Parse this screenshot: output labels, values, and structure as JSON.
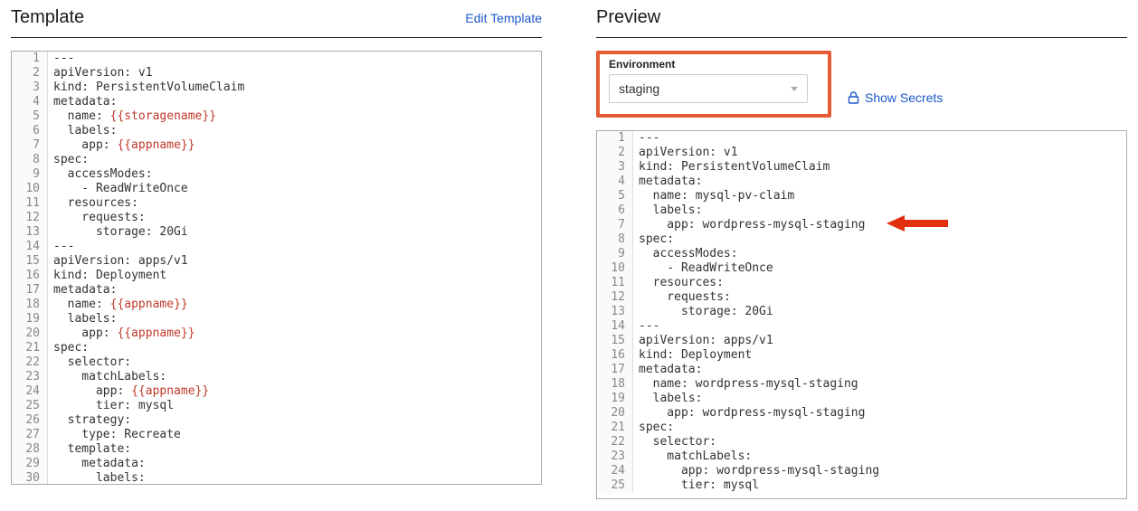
{
  "template": {
    "title": "Template",
    "edit_link": "Edit Template",
    "lines": [
      {
        "n": 1,
        "segs": [
          {
            "t": "---"
          }
        ]
      },
      {
        "n": 2,
        "segs": [
          {
            "t": "apiVersion: v1"
          }
        ]
      },
      {
        "n": 3,
        "segs": [
          {
            "t": "kind: PersistentVolumeClaim"
          }
        ]
      },
      {
        "n": 4,
        "segs": [
          {
            "t": "metadata:"
          }
        ]
      },
      {
        "n": 5,
        "segs": [
          {
            "t": "  name: "
          },
          {
            "t": "{{storagename}}",
            "cls": "tok-var"
          }
        ]
      },
      {
        "n": 6,
        "segs": [
          {
            "t": "  labels:"
          }
        ]
      },
      {
        "n": 7,
        "segs": [
          {
            "t": "    app: "
          },
          {
            "t": "{{appname}}",
            "cls": "tok-var"
          }
        ]
      },
      {
        "n": 8,
        "segs": [
          {
            "t": "spec:"
          }
        ]
      },
      {
        "n": 9,
        "segs": [
          {
            "t": "  accessModes:"
          }
        ]
      },
      {
        "n": 10,
        "segs": [
          {
            "t": "    - ReadWriteOnce"
          }
        ]
      },
      {
        "n": 11,
        "segs": [
          {
            "t": "  resources:"
          }
        ]
      },
      {
        "n": 12,
        "segs": [
          {
            "t": "    requests:"
          }
        ]
      },
      {
        "n": 13,
        "segs": [
          {
            "t": "      storage: 20Gi"
          }
        ]
      },
      {
        "n": 14,
        "segs": [
          {
            "t": "---"
          }
        ]
      },
      {
        "n": 15,
        "segs": [
          {
            "t": "apiVersion: apps/v1"
          }
        ]
      },
      {
        "n": 16,
        "segs": [
          {
            "t": "kind: Deployment"
          }
        ]
      },
      {
        "n": 17,
        "segs": [
          {
            "t": "metadata:"
          }
        ]
      },
      {
        "n": 18,
        "segs": [
          {
            "t": "  name: "
          },
          {
            "t": "{{appname}}",
            "cls": "tok-var"
          }
        ]
      },
      {
        "n": 19,
        "segs": [
          {
            "t": "  labels:"
          }
        ]
      },
      {
        "n": 20,
        "segs": [
          {
            "t": "    app: "
          },
          {
            "t": "{{appname}}",
            "cls": "tok-var"
          }
        ]
      },
      {
        "n": 21,
        "segs": [
          {
            "t": "spec:"
          }
        ]
      },
      {
        "n": 22,
        "segs": [
          {
            "t": "  selector:"
          }
        ]
      },
      {
        "n": 23,
        "segs": [
          {
            "t": "    matchLabels:"
          }
        ]
      },
      {
        "n": 24,
        "segs": [
          {
            "t": "      app: "
          },
          {
            "t": "{{appname}}",
            "cls": "tok-var"
          }
        ]
      },
      {
        "n": 25,
        "segs": [
          {
            "t": "      tier: mysql"
          }
        ]
      },
      {
        "n": 26,
        "segs": [
          {
            "t": "  strategy:"
          }
        ]
      },
      {
        "n": 27,
        "segs": [
          {
            "t": "    type: Recreate"
          }
        ]
      },
      {
        "n": 28,
        "segs": [
          {
            "t": "  template:"
          }
        ]
      },
      {
        "n": 29,
        "segs": [
          {
            "t": "    metadata:"
          }
        ]
      },
      {
        "n": 30,
        "segs": [
          {
            "t": "      labels:"
          }
        ]
      }
    ]
  },
  "preview": {
    "title": "Preview",
    "env_label": "Environment",
    "env_value": "staging",
    "show_secrets": "Show Secrets",
    "lines": [
      {
        "n": 1,
        "segs": [
          {
            "t": "---"
          }
        ]
      },
      {
        "n": 2,
        "segs": [
          {
            "t": "apiVersion: v1"
          }
        ]
      },
      {
        "n": 3,
        "segs": [
          {
            "t": "kind: PersistentVolumeClaim"
          }
        ]
      },
      {
        "n": 4,
        "segs": [
          {
            "t": "metadata:"
          }
        ]
      },
      {
        "n": 5,
        "segs": [
          {
            "t": "  name: mysql-pv-claim"
          }
        ]
      },
      {
        "n": 6,
        "segs": [
          {
            "t": "  labels:"
          }
        ]
      },
      {
        "n": 7,
        "segs": [
          {
            "t": "    app: wordpress-mysql-staging"
          }
        ]
      },
      {
        "n": 8,
        "segs": [
          {
            "t": "spec:"
          }
        ]
      },
      {
        "n": 9,
        "segs": [
          {
            "t": "  accessModes:"
          }
        ]
      },
      {
        "n": 10,
        "segs": [
          {
            "t": "    - ReadWriteOnce"
          }
        ]
      },
      {
        "n": 11,
        "segs": [
          {
            "t": "  resources:"
          }
        ]
      },
      {
        "n": 12,
        "segs": [
          {
            "t": "    requests:"
          }
        ]
      },
      {
        "n": 13,
        "segs": [
          {
            "t": "      storage: 20Gi"
          }
        ]
      },
      {
        "n": 14,
        "segs": [
          {
            "t": "---"
          }
        ]
      },
      {
        "n": 15,
        "segs": [
          {
            "t": "apiVersion: apps/v1"
          }
        ]
      },
      {
        "n": 16,
        "segs": [
          {
            "t": "kind: Deployment"
          }
        ]
      },
      {
        "n": 17,
        "segs": [
          {
            "t": "metadata:"
          }
        ]
      },
      {
        "n": 18,
        "segs": [
          {
            "t": "  name: wordpress-mysql-staging"
          }
        ]
      },
      {
        "n": 19,
        "segs": [
          {
            "t": "  labels:"
          }
        ]
      },
      {
        "n": 20,
        "segs": [
          {
            "t": "    app: wordpress-mysql-staging"
          }
        ]
      },
      {
        "n": 21,
        "segs": [
          {
            "t": "spec:"
          }
        ]
      },
      {
        "n": 22,
        "segs": [
          {
            "t": "  selector:"
          }
        ]
      },
      {
        "n": 23,
        "segs": [
          {
            "t": "    matchLabels:"
          }
        ]
      },
      {
        "n": 24,
        "segs": [
          {
            "t": "      app: wordpress-mysql-staging"
          }
        ]
      },
      {
        "n": 25,
        "segs": [
          {
            "t": "      tier: mysql"
          }
        ]
      }
    ]
  },
  "annotations": {
    "env_highlight_color": "#e65a35",
    "arrow_color": "#e22f0f"
  }
}
